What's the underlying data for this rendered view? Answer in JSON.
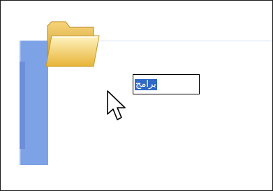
{
  "window": {
    "file_item": {
      "icon": "folder-icon",
      "rename_value": "برامج"
    }
  },
  "cursor": {
    "icon": "arrow-cursor-icon"
  },
  "colors": {
    "sidebar": "#7da2e6",
    "selection": "#316ac5",
    "folder_body": "#f2c84b"
  }
}
